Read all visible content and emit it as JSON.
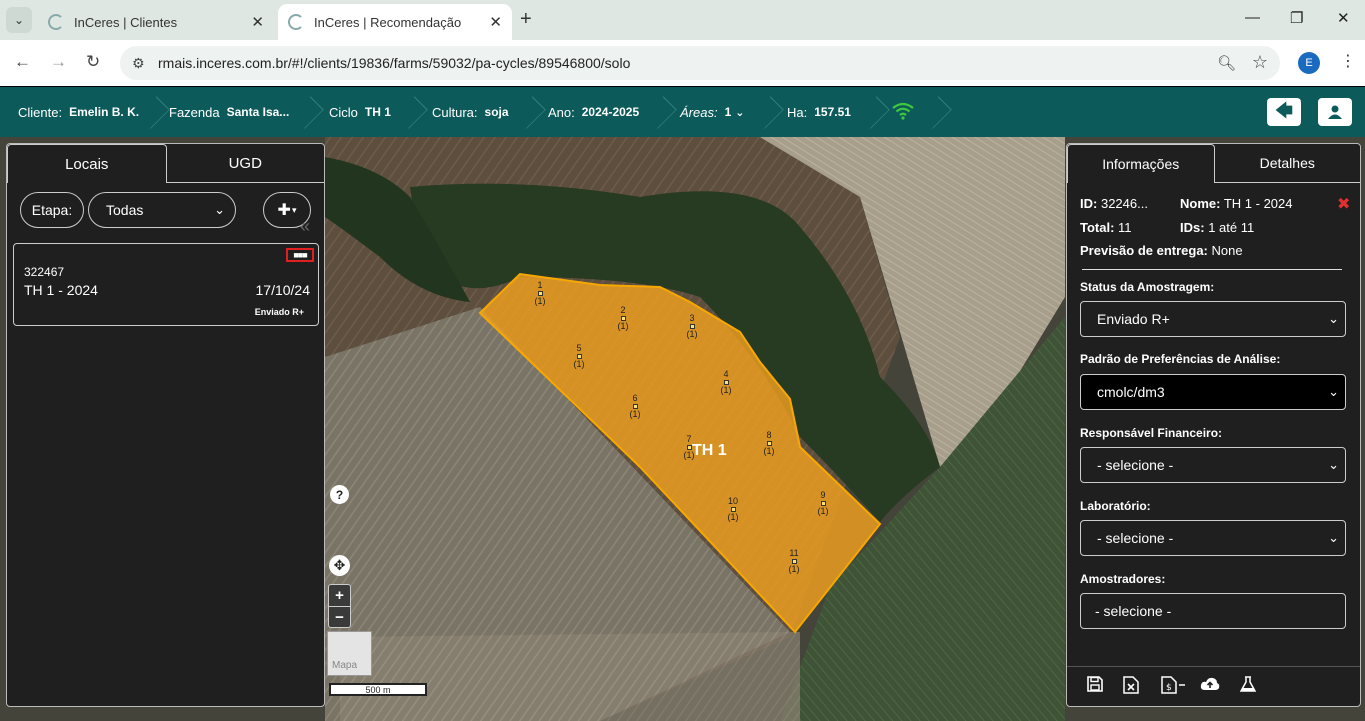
{
  "browser": {
    "tabs": [
      {
        "title": "InCeres | Clientes"
      },
      {
        "title": "InCeres | Recomendação"
      }
    ],
    "url": "rmais.inceres.com.br/#!/clients/19836/farms/59032/pa-cycles/89546800/solo",
    "profile_initial": "E"
  },
  "appbar": {
    "cliente_label": "Cliente:",
    "cliente_value": "Emelin B. K.",
    "fazenda_label": "Fazenda",
    "fazenda_value": "Santa Isa...",
    "ciclo_label": "Ciclo",
    "ciclo_value": "TH 1",
    "cultura_label": "Cultura:",
    "cultura_value": "soja",
    "ano_label": "Ano:",
    "ano_value": "2024-2025",
    "areas_label": "Áreas:",
    "areas_value": "1",
    "ha_label": "Ha:",
    "ha_value": "157.51"
  },
  "left_panel": {
    "tabs": [
      "Locais",
      "UGD"
    ],
    "etapa_label": "Etapa:",
    "etapa_select": "Todas",
    "card": {
      "id": "322467",
      "name": "TH 1 - 2024",
      "date": "17/10/24",
      "status": "Enviado R+"
    }
  },
  "map": {
    "field_label": "TH 1",
    "points": [
      {
        "id": "1",
        "count": "(1)"
      },
      {
        "id": "2",
        "count": "(1)"
      },
      {
        "id": "3",
        "count": "(1)"
      },
      {
        "id": "4",
        "count": "(1)"
      },
      {
        "id": "5",
        "count": "(1)"
      },
      {
        "id": "6",
        "count": "(1)"
      },
      {
        "id": "7",
        "count": "(1)"
      },
      {
        "id": "8",
        "count": "(1)"
      },
      {
        "id": "9",
        "count": "(1)"
      },
      {
        "id": "10",
        "count": "(1)"
      },
      {
        "id": "11",
        "count": "(1)"
      }
    ],
    "thumb_label": "Mapa",
    "scale_label": "500 m",
    "field_color": "#f0a020"
  },
  "right_panel": {
    "tabs": [
      "Informações",
      "Detalhes"
    ],
    "id_label": "ID:",
    "id_value": "32246...",
    "nome_label": "Nome:",
    "nome_value": "TH 1 - 2024",
    "total_label": "Total:",
    "total_value": "11",
    "ids_label": "IDs:",
    "ids_value": "1 até 11",
    "previsao_label": "Previsão de entrega:",
    "previsao_value": "None",
    "fields": [
      {
        "label": "Status da Amostragem:",
        "value": "Enviado R+"
      },
      {
        "label": "Padrão de Preferências de Análise:",
        "value": "cmolc/dm3"
      },
      {
        "label": "Responsável Financeiro:",
        "value": "- selecione -"
      },
      {
        "label": "Laboratório:",
        "value": "- selecione -"
      },
      {
        "label": "Amostradores:",
        "value": "- selecione -"
      }
    ]
  }
}
